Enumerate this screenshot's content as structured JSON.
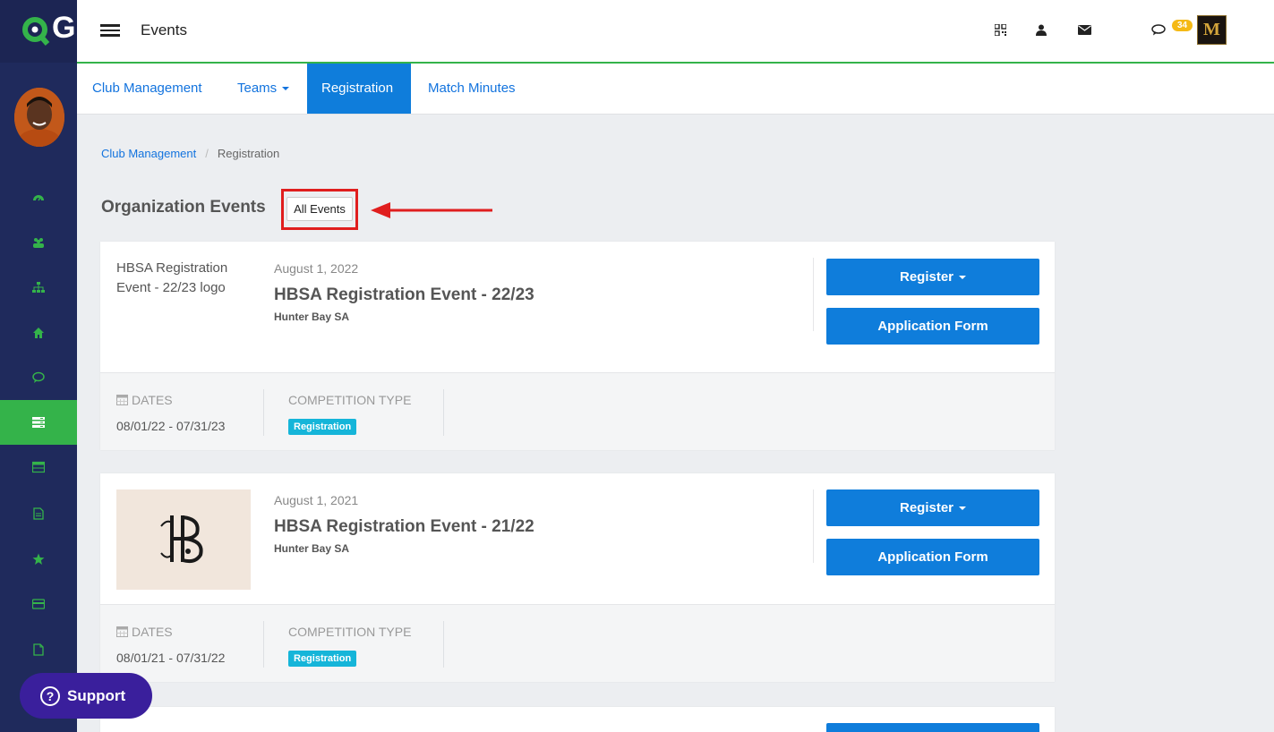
{
  "app": {
    "logo_letter": "G"
  },
  "topbar": {
    "title": "Events",
    "mail_badge": "34",
    "user_initial": "M"
  },
  "tabs": [
    {
      "label": "Club Management"
    },
    {
      "label": "Teams"
    },
    {
      "label": "Registration"
    },
    {
      "label": "Match Minutes"
    }
  ],
  "breadcrumb": {
    "parent": "Club Management",
    "current": "Registration"
  },
  "section": {
    "title": "Organization Events",
    "filter_button": "All Events"
  },
  "events": [
    {
      "image_alt": "HBSA Registration Event - 22/23 logo",
      "date": "August 1, 2022",
      "name": "HBSA Registration Event - 22/23",
      "org": "Hunter Bay SA",
      "register_label": "Register",
      "application_label": "Application Form",
      "dates_label": "DATES",
      "dates_value": "08/01/22 - 07/31/23",
      "competition_label": "COMPETITION TYPE",
      "competition_value": "Registration"
    },
    {
      "image_alt": "",
      "date": "August 1, 2021",
      "name": "HBSA Registration Event - 21/22",
      "org": "Hunter Bay SA",
      "register_label": "Register",
      "application_label": "Application Form",
      "dates_label": "DATES",
      "dates_value": "08/01/21 - 07/31/22",
      "competition_label": "COMPETITION TYPE",
      "competition_value": "Registration"
    }
  ],
  "support": {
    "label": "Support"
  },
  "colors": {
    "sidebar": "#1f2a5c",
    "accent_green": "#34b34a",
    "primary_blue": "#0f7ddb",
    "badge_cyan": "#15b5d9",
    "highlight_red": "#e01e1e"
  }
}
